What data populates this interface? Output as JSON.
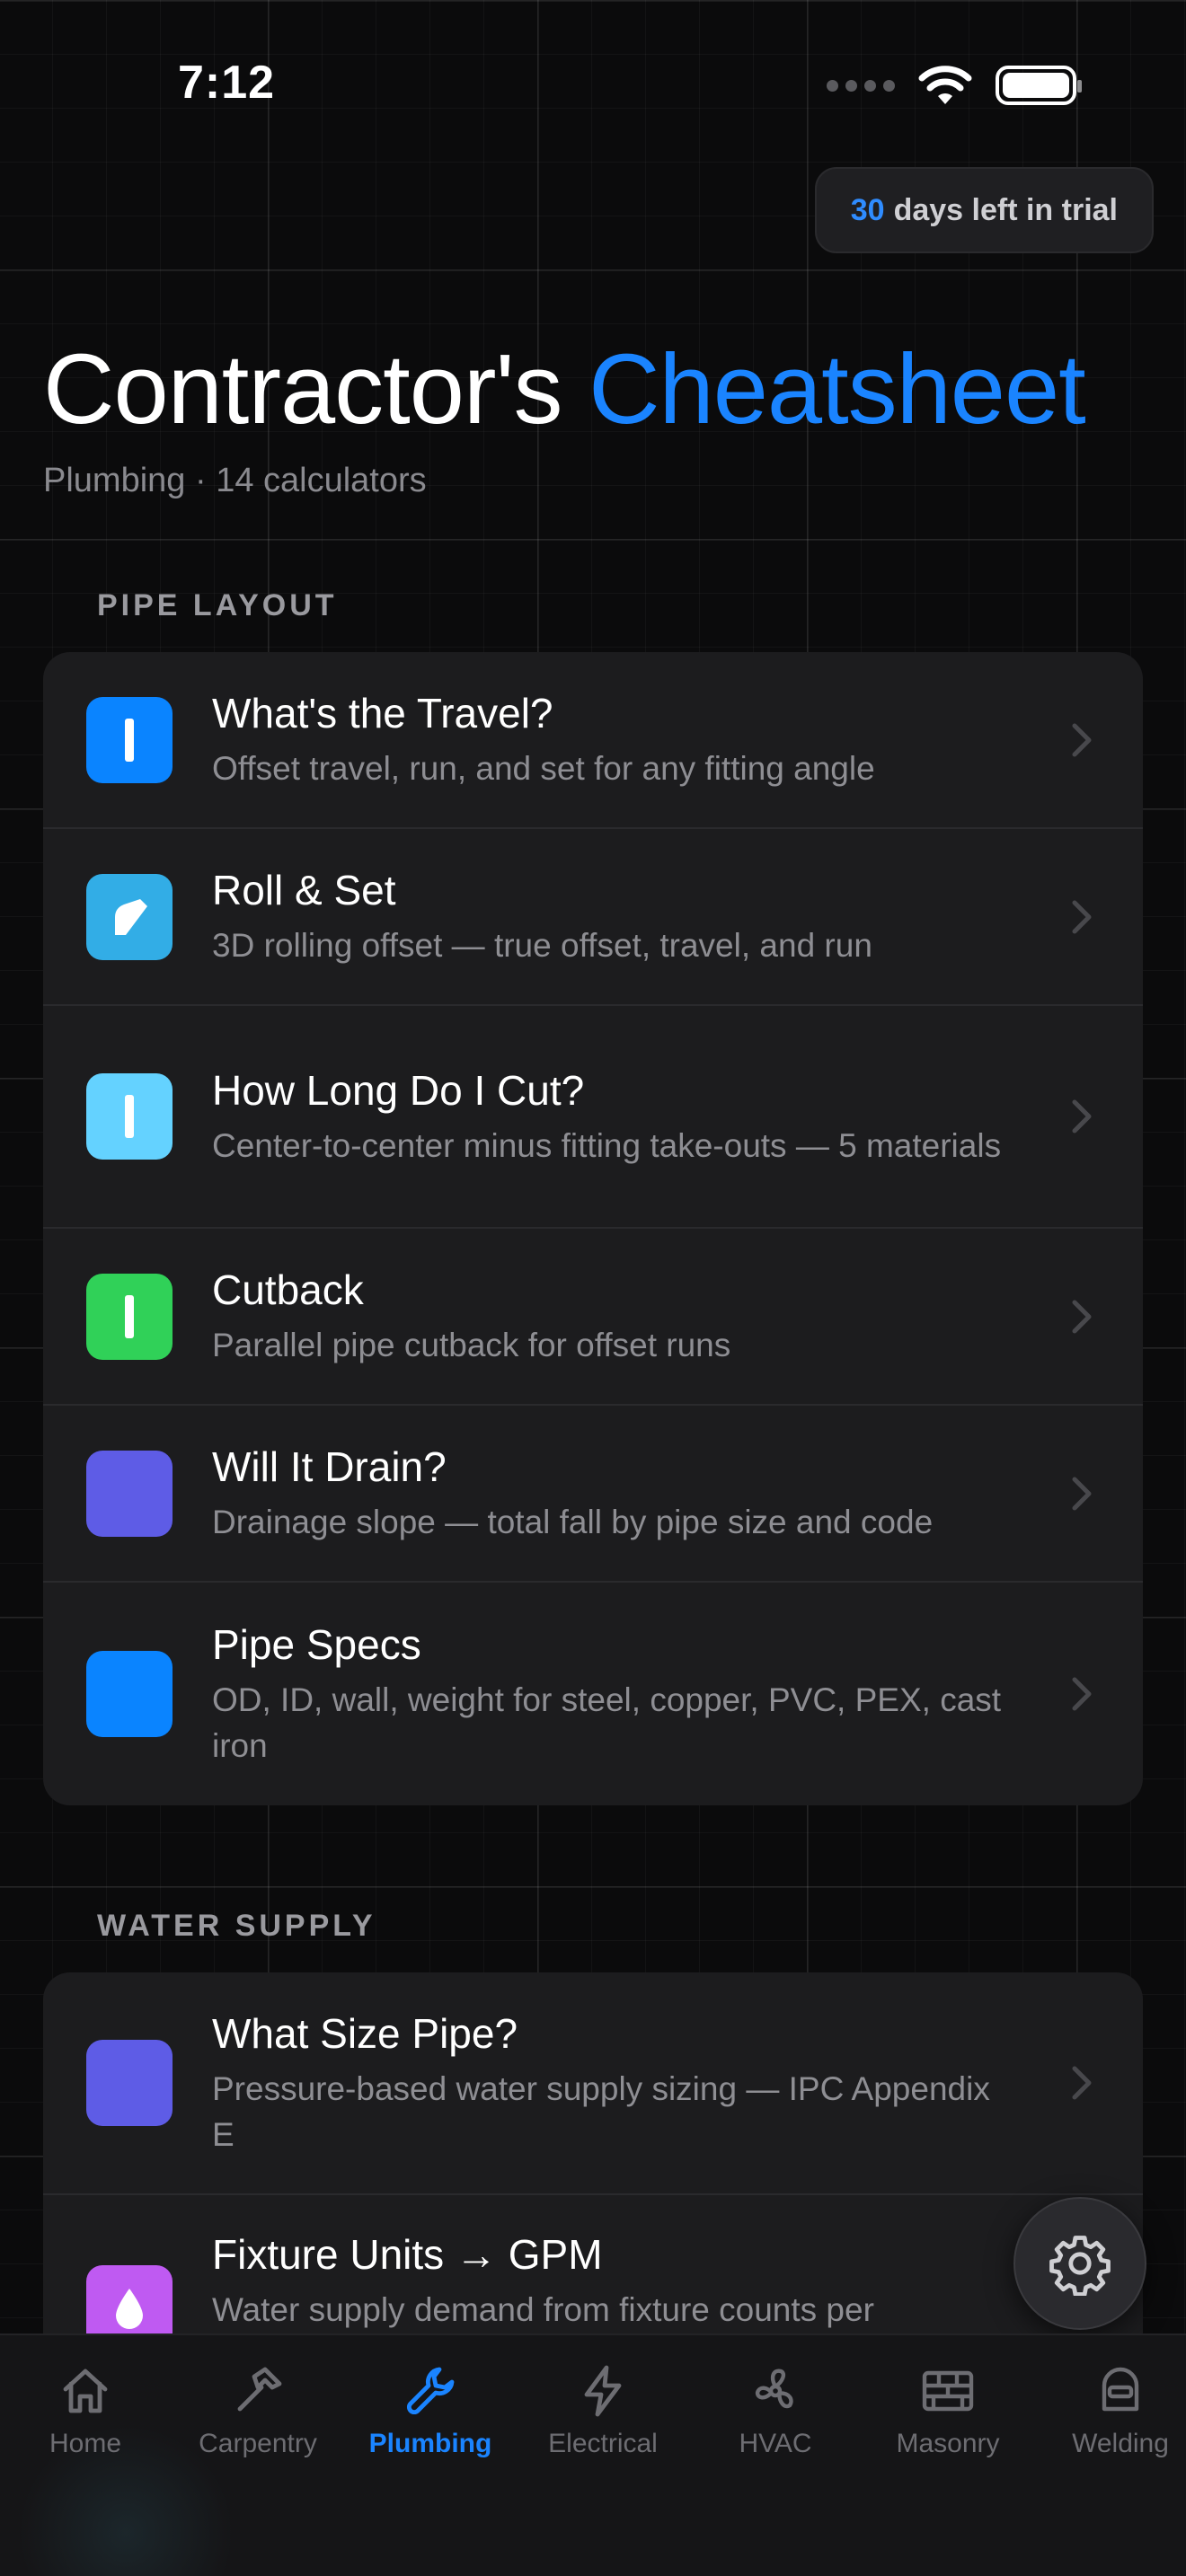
{
  "status_bar": {
    "time": "7:12"
  },
  "trial": {
    "days": "30",
    "text": "days left in trial"
  },
  "header": {
    "title_main": "Contractor's",
    "title_accent": "Cheatsheet",
    "subtitle": "Plumbing · 14 calculators"
  },
  "sections": [
    {
      "header": "PIPE LAYOUT",
      "items": [
        {
          "title": "What's the Travel?",
          "desc": "Offset travel, run, and set for any fitting angle",
          "color": "#0a84ff"
        },
        {
          "title": "Roll & Set",
          "desc": "3D rolling offset — true offset, travel, and run",
          "color": "#32ade6"
        },
        {
          "title": "How Long Do I Cut?",
          "desc": "Center-to-center minus fitting take-outs — 5 materials",
          "color": "#64d2ff"
        },
        {
          "title": "Cutback",
          "desc": "Parallel pipe cutback for offset runs",
          "color": "#30d158"
        },
        {
          "title": "Will It Drain?",
          "desc": "Drainage slope — total fall by pipe size and code",
          "color": "#5e5ce6"
        },
        {
          "title": "Pipe Specs",
          "desc": "OD, ID, wall, weight for steel, copper, PVC, PEX, cast iron",
          "color": "#0a84ff"
        }
      ]
    },
    {
      "header": "WATER SUPPLY",
      "items": [
        {
          "title": "What Size Pipe?",
          "desc": "Pressure-based water supply sizing — IPC Appendix E",
          "color": "#5e5ce6"
        },
        {
          "title": "Fixture Units → GPM",
          "desc": "Water supply demand from fixture counts per",
          "color": "#bf5af2"
        }
      ]
    }
  ],
  "tabs": [
    {
      "label": "Home",
      "icon": "home-icon"
    },
    {
      "label": "Carpentry",
      "icon": "hammer-icon"
    },
    {
      "label": "Plumbing",
      "icon": "wrench-icon",
      "active": true
    },
    {
      "label": "Electrical",
      "icon": "bolt-icon"
    },
    {
      "label": "HVAC",
      "icon": "fan-icon"
    },
    {
      "label": "Masonry",
      "icon": "brick-icon"
    },
    {
      "label": "Welding",
      "icon": "welding-mask-icon"
    }
  ],
  "colors": {
    "accent": "#1a84ff",
    "background": "#0b0b0c",
    "card": "#1c1c1e"
  }
}
